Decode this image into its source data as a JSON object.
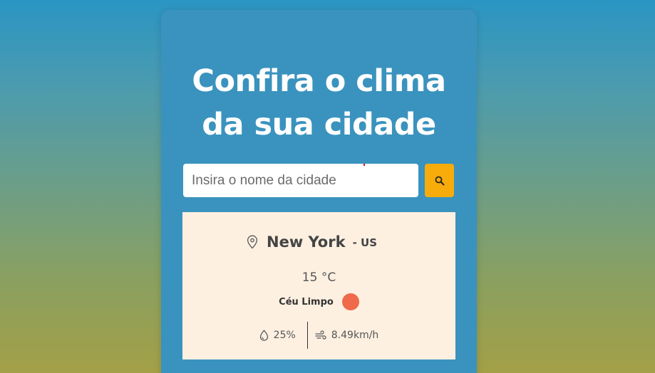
{
  "header": {
    "title_line1": "Confira o clima",
    "title_line2": "da sua cidade"
  },
  "search": {
    "placeholder": "Insira o nome da cidade",
    "value": "",
    "button_icon": "search-icon"
  },
  "weather": {
    "city": "New York",
    "country": "- US",
    "temperature": "15 °C",
    "description": "Céu Limpo",
    "humidity": "25%",
    "wind": "8.49km/h",
    "location_icon": "map-pin-icon",
    "condition_icon": "sun-icon",
    "humidity_icon": "droplet-icon",
    "wind_icon": "wind-icon"
  },
  "colors": {
    "card": "#3a93be",
    "search_button": "#f7ac0b",
    "panel": "#fdf0e1",
    "condition_icon": "#ef6a4a"
  }
}
